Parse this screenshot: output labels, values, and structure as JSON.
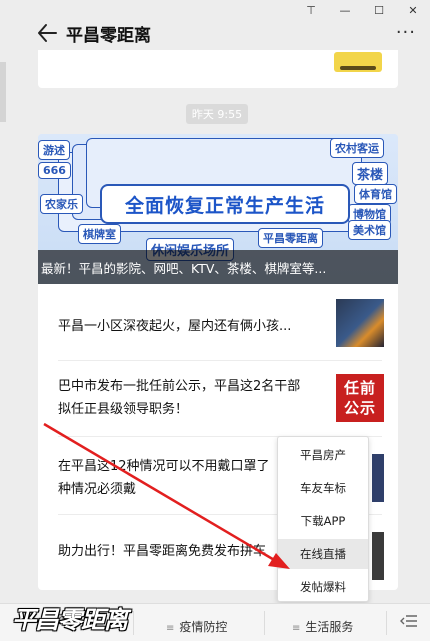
{
  "window": {
    "title": "平昌零距离",
    "controls": [
      "⊤",
      "—",
      "☐",
      "✕"
    ]
  },
  "chat": {
    "timestamp": "昨天 9:55"
  },
  "banner": {
    "headline": "全面恢复正常生产生活",
    "tags": [
      "游述",
      "666",
      "农家乐",
      "棋牌室",
      "休闲娱乐场所",
      "平昌零距离",
      "农村客运",
      "茶楼",
      "体育馆",
      "博物馆",
      "美术馆"
    ],
    "caption": "最新！平昌的影院、网吧、KTV、茶楼、棋牌室等..."
  },
  "articles": [
    {
      "title": "平昌一小区深夜起火，屋内还有俩小孩..."
    },
    {
      "title": "巴中市发布一批任前公示，平昌这2名干部拟任正县级领导职务！",
      "thumb_text": [
        "任前",
        "公示"
      ]
    },
    {
      "title": "在平昌这12种情况可以不用戴口罩了种情况必须戴"
    },
    {
      "title": "助力出行！平昌零距离免费发布拼车"
    }
  ],
  "popup_menu": {
    "items": [
      "平昌房产",
      "车友车标",
      "下载APP",
      "在线直播",
      "发帖爆料"
    ],
    "highlighted": "在线直播"
  },
  "bottom_bar": {
    "tabs": [
      "疫情防控",
      "生活服务"
    ],
    "watermark": "平昌零距离"
  },
  "colors": {
    "accent_blue": "#1c55c8",
    "arrow_red": "#e21f1f",
    "thumb_red": "#c8201f"
  }
}
